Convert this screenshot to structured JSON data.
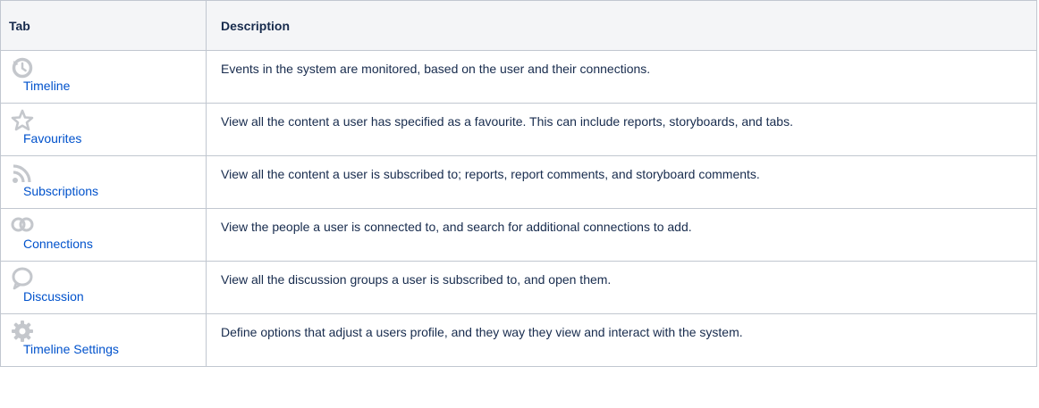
{
  "table": {
    "headers": {
      "tab": "Tab",
      "description": "Description"
    },
    "rows": [
      {
        "icon": "timeline-icon",
        "label": "Timeline",
        "description": "Events in the system are monitored, based on the user and their connections."
      },
      {
        "icon": "favourites-star-icon",
        "label": "Favourites",
        "description": "View all the content a user has specified as a favourite. This can include reports, storyboards, and tabs."
      },
      {
        "icon": "subscriptions-rss-icon",
        "label": "Subscriptions",
        "description": "View all the content a user is subscribed to; reports, report comments, and storyboard comments."
      },
      {
        "icon": "connections-icon",
        "label": "Connections",
        "description": "View the people a user is connected to, and search for additional connections to add."
      },
      {
        "icon": "discussion-bubble-icon",
        "label": "Discussion",
        "description": "View all the discussion groups a user is subscribed to, and open them."
      },
      {
        "icon": "settings-gear-icon",
        "label": "Timeline Settings",
        "description": "Define options that adjust a users profile, and they way they view and interact with the system."
      }
    ]
  },
  "colors": {
    "link": "#0052cc",
    "text": "#172b4d",
    "header_bg": "#f4f5f7",
    "border": "#c1c7d0",
    "icon_gray": "#c4c7cc"
  }
}
